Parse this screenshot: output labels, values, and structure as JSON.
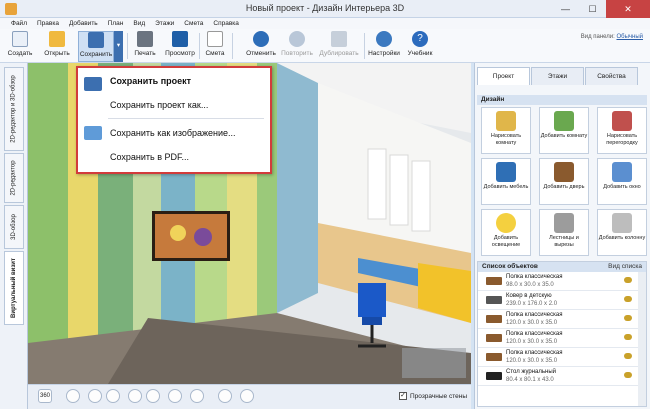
{
  "window": {
    "title": "Новый проект - Дизайн Интерьера 3D",
    "minimize": "—",
    "maximize": "☐",
    "close": "✕"
  },
  "menu": [
    "Файл",
    "Правка",
    "Добавить",
    "План",
    "Вид",
    "Этажи",
    "Смета",
    "Справка"
  ],
  "toolbar": {
    "create": "Создать",
    "open": "Открыть",
    "save": "Сохранить",
    "print": "Печать",
    "preview": "Просмотр",
    "estimate": "Смета",
    "undo": "Отменить",
    "redo": "Повторить",
    "duplicate": "Дублировать",
    "settings": "Настройки",
    "tutorial": "Учебник",
    "view_panel_label": "Вид панели:",
    "view_panel_value": "Обычный"
  },
  "left_tabs": [
    "2D-редактор и 3D-обзор",
    "2D-редактор",
    "3D-обзор",
    "Виртуальный визит"
  ],
  "save_menu": {
    "save_project": "Сохранить проект",
    "save_project_as": "Сохранить проект как...",
    "save_as_image": "Сохранить как изображение...",
    "save_pdf": "Сохранить в PDF..."
  },
  "bottom": {
    "transparent_walls": "Прозрачные стены",
    "view360": "360"
  },
  "right_panel": {
    "tabs": [
      "Проект",
      "Этажи",
      "Свойства"
    ],
    "design_title": "Дизайн",
    "design_buttons": [
      "Нарисовать комнату",
      "Добавить комнату",
      "Нарисовать перегородку",
      "Добавить мебель",
      "Добавить дверь",
      "Добавить окно",
      "Добавить освещение",
      "Лестницы и вырезы",
      "Добавить колонну"
    ],
    "objects_title": "Список объектов",
    "objects_view": "Вид списка",
    "objects": [
      {
        "name": "Полка классическая",
        "size": "98.0 x 30.0 x 35.0"
      },
      {
        "name": "Ковер в детскую",
        "size": "239.0 x 176.0 x 2.0"
      },
      {
        "name": "Полка классическая",
        "size": "120.0 x 30.0 x 35.0"
      },
      {
        "name": "Полка классическая",
        "size": "120.0 x 30.0 x 35.0"
      },
      {
        "name": "Полка классическая",
        "size": "120.0 x 30.0 x 35.0"
      },
      {
        "name": "Стол журнальный",
        "size": "80.4 x 80.1 x 43.0"
      }
    ]
  }
}
